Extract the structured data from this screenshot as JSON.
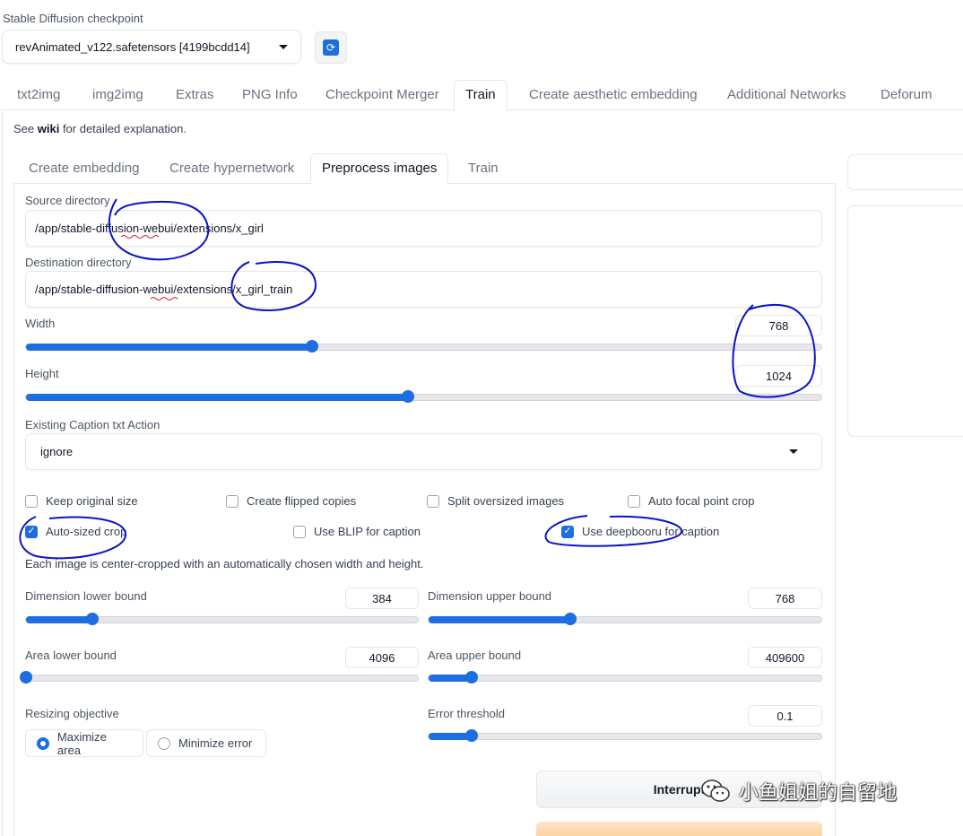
{
  "checkpoint": {
    "label": "Stable Diffusion checkpoint",
    "selected": "revAnimated_v122.safetensors [4199bcdd14]",
    "refresh_icon": "refresh-icon"
  },
  "top_tabs": [
    {
      "label": "txt2img"
    },
    {
      "label": "img2img"
    },
    {
      "label": "Extras"
    },
    {
      "label": "PNG Info"
    },
    {
      "label": "Checkpoint Merger"
    },
    {
      "label": "Train",
      "active": true
    },
    {
      "label": "Create aesthetic embedding"
    },
    {
      "label": "Additional Networks"
    },
    {
      "label": "Deforum"
    }
  ],
  "wiki": {
    "prefix": "See ",
    "link": "wiki",
    "suffix": " for detailed explanation."
  },
  "sub_tabs": [
    {
      "label": "Create embedding"
    },
    {
      "label": "Create hypernetwork"
    },
    {
      "label": "Preprocess images",
      "active": true
    },
    {
      "label": "Train"
    }
  ],
  "form": {
    "source_dir_label": "Source directory",
    "source_dir_value": "/app/stable-diffusion-webui/extensions/x_girl",
    "dest_dir_label": "Destination directory",
    "dest_dir_value": "/app/stable-diffusion-webui/extensions/x_girl_train",
    "width": {
      "label": "Width",
      "value": "768",
      "fraction": 0.36
    },
    "height": {
      "label": "Height",
      "value": "1024",
      "fraction": 0.48
    },
    "caption_action": {
      "label": "Existing Caption txt Action",
      "selected": "ignore"
    },
    "checkboxes_row1": [
      {
        "label": "Keep original size",
        "checked": false
      },
      {
        "label": "Create flipped copies",
        "checked": false
      },
      {
        "label": "Split oversized images",
        "checked": false
      },
      {
        "label": "Auto focal point crop",
        "checked": false
      }
    ],
    "checkboxes_row2": [
      {
        "label": "Auto-sized crop",
        "checked": true
      },
      {
        "label": "Use BLIP for caption",
        "checked": false
      },
      {
        "label": "Use deepbooru for caption",
        "checked": true
      }
    ],
    "autocrop_note": "Each image is center-cropped with an automatically chosen width and height.",
    "dim_lower": {
      "label": "Dimension lower bound",
      "value": "384",
      "fraction": 0.17
    },
    "dim_upper": {
      "label": "Dimension upper bound",
      "value": "768",
      "fraction": 0.36
    },
    "area_lower": {
      "label": "Area lower bound",
      "value": "4096",
      "fraction": 0.0
    },
    "area_upper": {
      "label": "Area upper bound",
      "value": "409600",
      "fraction": 0.11
    },
    "resizing_objective": {
      "label": "Resizing objective",
      "options": [
        {
          "label": "Maximize area",
          "selected": true
        },
        {
          "label": "Minimize error",
          "selected": false
        }
      ]
    },
    "error_threshold": {
      "label": "Error threshold",
      "value": "0.1",
      "fraction": 0.11
    }
  },
  "buttons": {
    "interrupt": "Interrupt"
  },
  "watermark": {
    "text": "小鱼姐姐的自留地",
    "icon": "wechat-icon"
  },
  "colors": {
    "accent": "#1d6ee0",
    "annotation": "#0a14c8",
    "primary_button": "#fbd3a3"
  }
}
